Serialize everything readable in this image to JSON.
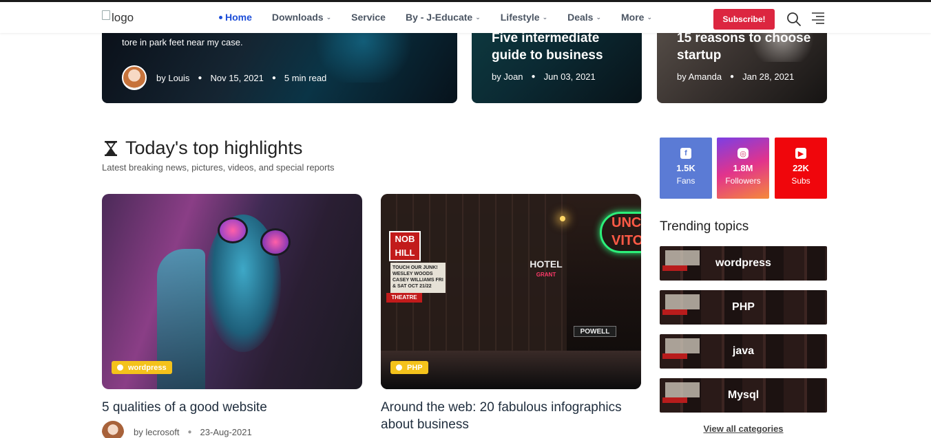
{
  "header": {
    "logo_alt": "logo",
    "nav": [
      {
        "label": "Home",
        "active": true,
        "caret": false
      },
      {
        "label": "Downloads",
        "active": false,
        "caret": true
      },
      {
        "label": "Service",
        "active": false,
        "caret": false
      },
      {
        "label": "By - J-Educate",
        "active": false,
        "caret": true
      },
      {
        "label": "Lifestyle",
        "active": false,
        "caret": true
      },
      {
        "label": "Deals",
        "active": false,
        "caret": true
      },
      {
        "label": "More",
        "active": false,
        "caret": true
      }
    ],
    "subscribe_label": "Subscribe!",
    "icons": [
      "search-icon",
      "menu-icon"
    ]
  },
  "top_cards": [
    {
      "snippet": "tore in park feet near my case.",
      "author": "by Louis",
      "date": "Nov 15, 2021",
      "read_time": "5 min read"
    },
    {
      "title": "Five intermediate guide to business",
      "author": "by Joan",
      "date": "Jun 03, 2021"
    },
    {
      "title": "15 reasons to choose startup",
      "author": "by Amanda",
      "date": "Jan 28, 2021"
    }
  ],
  "highlights": {
    "icon": "hourglass-icon",
    "title": "Today's top highlights",
    "subtitle": "Latest breaking news, pictures, videos, and special reports",
    "posts": [
      {
        "category": "wordpress",
        "title": "5 qualities of a good website",
        "author": "by lecrosoft",
        "date": "23-Aug-2021"
      },
      {
        "category": "PHP",
        "title": "Around the web: 20 fabulous infographics about business"
      }
    ]
  },
  "social": [
    {
      "icon": "facebook-icon",
      "count": "1.5K",
      "label": "Fans",
      "color": "#5b7bd5"
    },
    {
      "icon": "instagram-icon",
      "count": "1.8M",
      "label": "Followers",
      "color": "#e2338c"
    },
    {
      "icon": "youtube-icon",
      "count": "22K",
      "label": "Subs",
      "color": "#f0060c"
    }
  ],
  "trending": {
    "title": "Trending topics",
    "topics": [
      "wordpress",
      "PHP",
      "java",
      "Mysql"
    ],
    "view_all_label": "View all categories"
  },
  "image_text": {
    "sign_nob": "NOB HILL",
    "sign_marquee": "TOUCH OUR JUNK! WESLEY WOODS CASEY WILLIAMS FRI & SAT OCT 21/22",
    "sign_theatre": "THEATRE",
    "sign_hotel": "HOTEL",
    "sign_hotel_sub": "GRANT",
    "sign_unc": "UNC VITO",
    "sign_powell": "POWELL"
  },
  "colors": {
    "accent": "#1d4ed8",
    "subscribe": "#dc2640",
    "badge": "#f4c21b"
  }
}
